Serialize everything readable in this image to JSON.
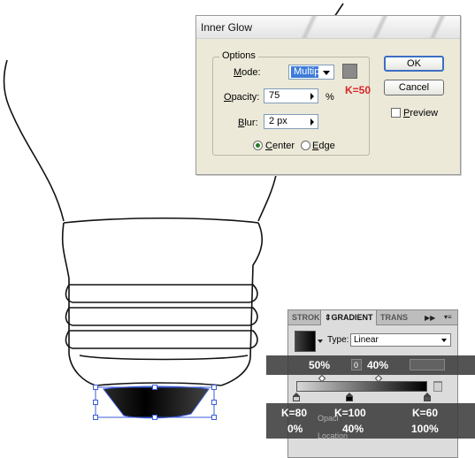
{
  "dialog": {
    "title": "Inner Glow",
    "options_label": "Options",
    "mode": {
      "label_hotkey": "M",
      "label_rest": "ode:",
      "value": "Multiply"
    },
    "opacity": {
      "label_hotkey": "O",
      "label_rest": "pacity:",
      "value": "75",
      "unit": "%"
    },
    "blur": {
      "label_hotkey": "B",
      "label_rest": "lur:",
      "value": "2 px"
    },
    "center": {
      "label_hotkey": "C",
      "label_rest": "enter",
      "selected": true
    },
    "edge": {
      "label_hotkey": "E",
      "label_rest": "dge",
      "selected": false
    },
    "ok_label": "OK",
    "cancel_label": "Cancel",
    "preview": {
      "label_hotkey": "P",
      "label_rest": "review",
      "checked": false
    },
    "glow_color": "#8a8a8a"
  },
  "annotations": {
    "k50": "K=50",
    "stop_overlay": {
      "k_values": [
        "K=80",
        "K=100",
        "K=60"
      ],
      "percents": [
        "0%",
        "40%",
        "100%"
      ]
    },
    "midpoint_overlay": {
      "left": "50%",
      "right": "40%"
    }
  },
  "gradient_panel": {
    "tabs": [
      "STROK",
      "GRADIENT",
      "TRANS"
    ],
    "active_tab": "GRADIENT",
    "type_label": "Type:",
    "type_value": "Linear",
    "small_field_value": "0",
    "ghost_labels": [
      "Opaci",
      "Location"
    ]
  }
}
